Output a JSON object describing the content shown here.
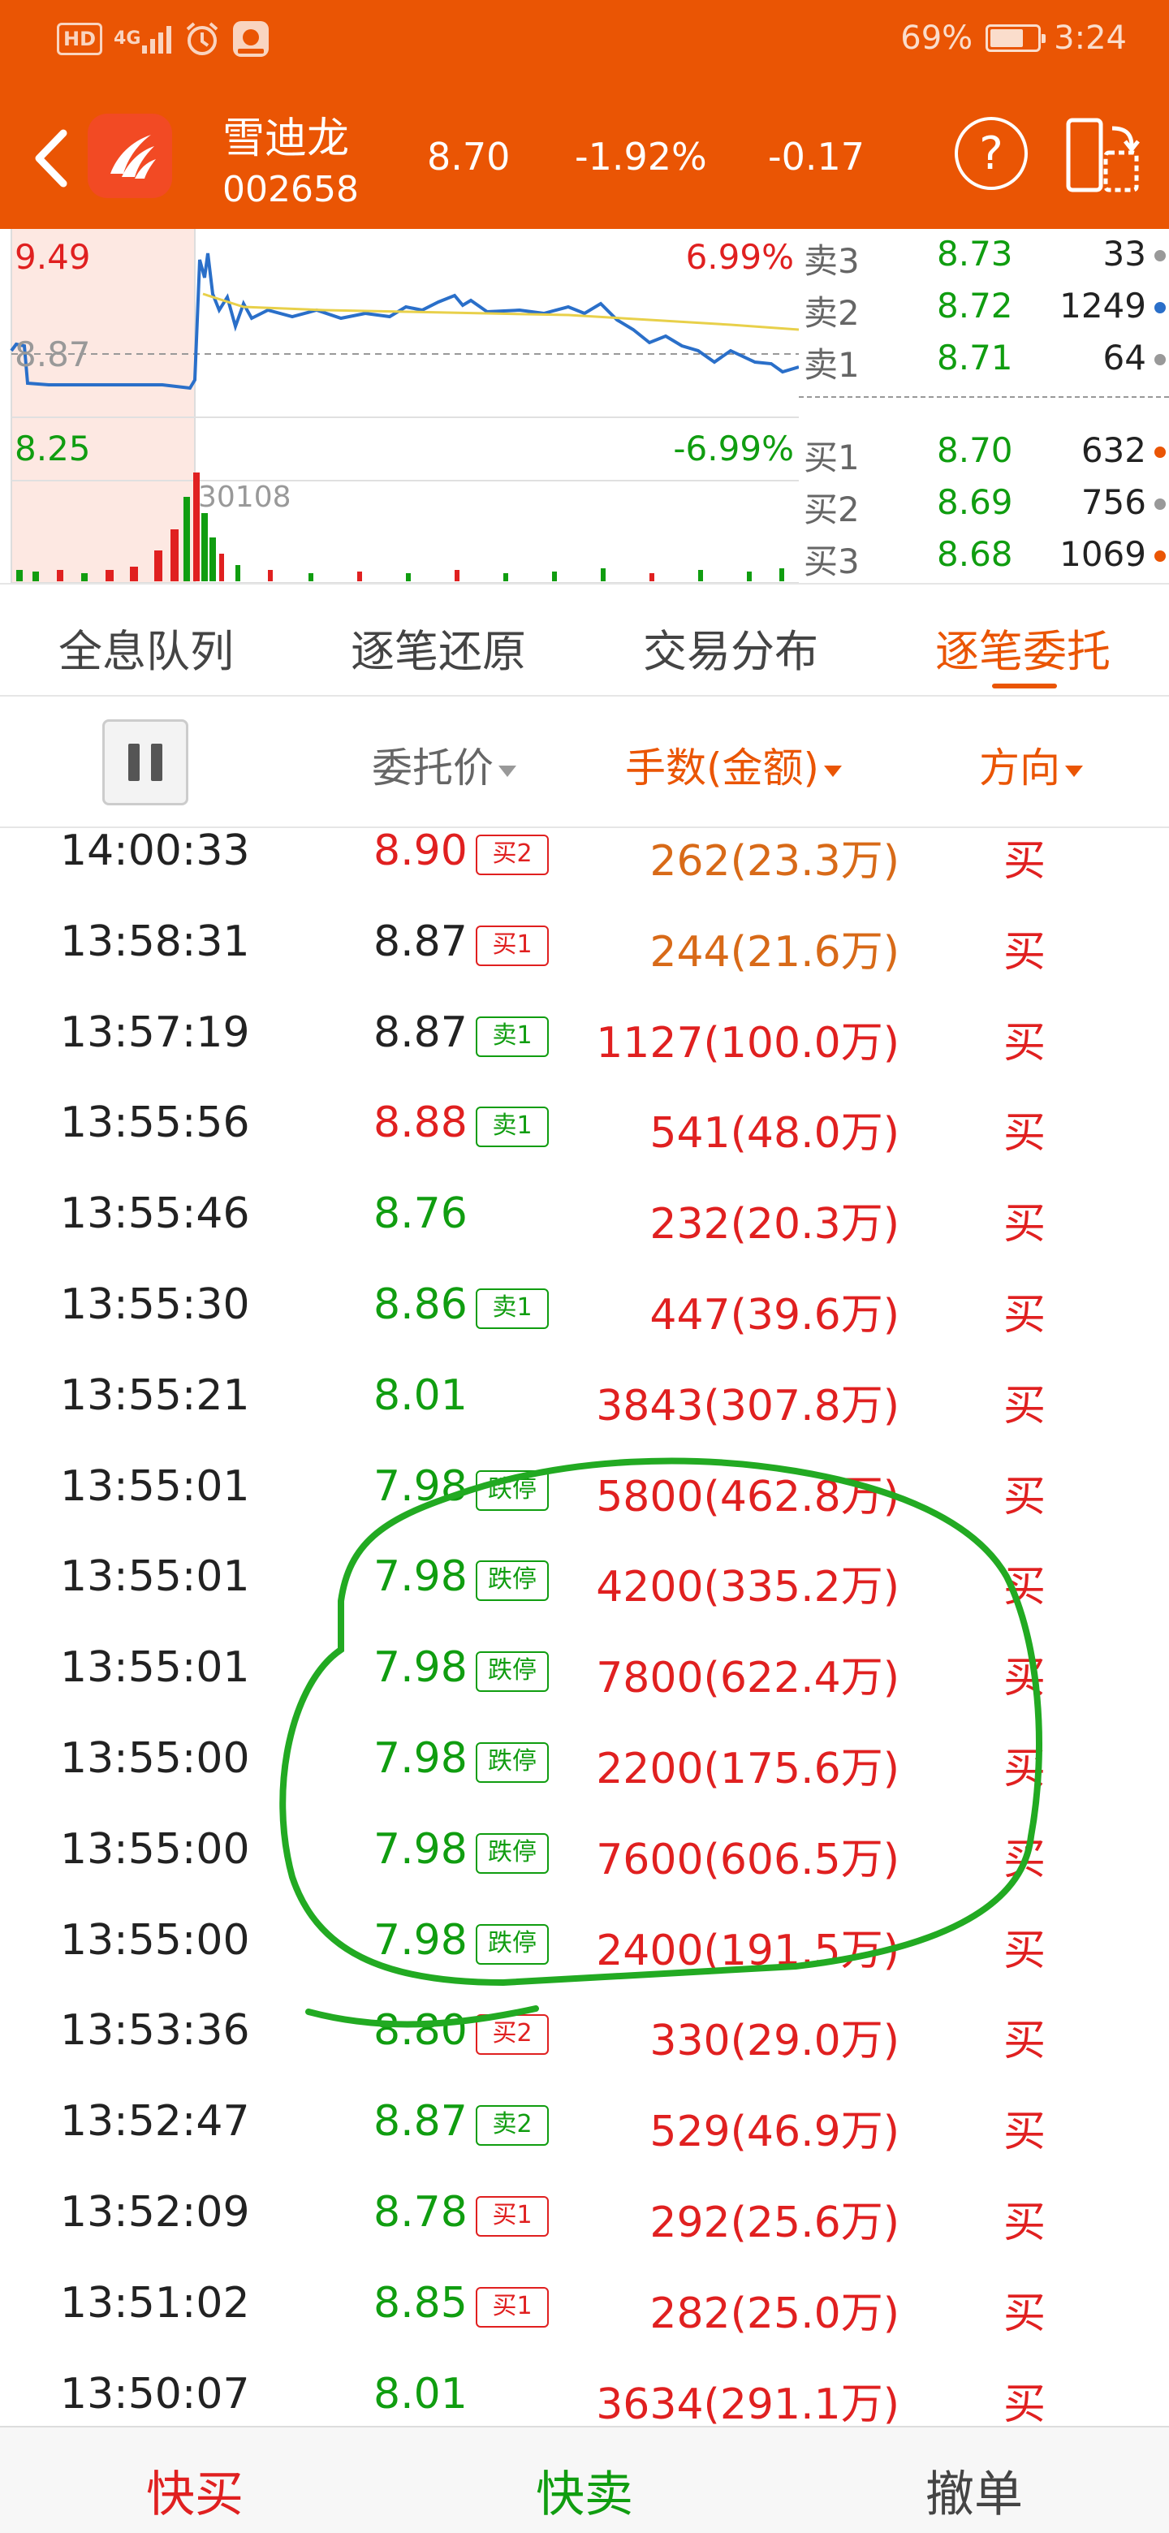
{
  "status_bar": {
    "hd": "HD",
    "network": "4G",
    "battery": "69%",
    "time": "3:24",
    "icons": [
      "signal-icon",
      "alarm-icon",
      "app-notification-icon",
      "battery-icon"
    ]
  },
  "header": {
    "name": "雪迪龙",
    "code": "002658",
    "price": "8.70",
    "change_pct": "-1.92%",
    "change": "-0.17",
    "help_symbol": "?",
    "icons": [
      "back-arrow-icon",
      "brand-logo-icon",
      "help-icon",
      "landscape-switch-icon"
    ]
  },
  "chart": {
    "high": "9.49",
    "mid": "8.87",
    "low": "8.25",
    "high_pct": "6.99%",
    "low_pct": "-6.99%",
    "volume_label": "30108"
  },
  "order_book": {
    "asks": [
      {
        "label": "卖3",
        "price": "8.73",
        "vol": "33",
        "dot": "#999999"
      },
      {
        "label": "卖2",
        "price": "8.72",
        "vol": "1249",
        "dot": "#2a6fc9"
      },
      {
        "label": "卖1",
        "price": "8.71",
        "vol": "64",
        "dot": "#999999"
      }
    ],
    "bids": [
      {
        "label": "买1",
        "price": "8.70",
        "vol": "632",
        "dot": "#ea5504"
      },
      {
        "label": "买2",
        "price": "8.69",
        "vol": "756",
        "dot": "#999999"
      },
      {
        "label": "买3",
        "price": "8.68",
        "vol": "1069",
        "dot": "#ea5504"
      }
    ]
  },
  "tabs": [
    "全息队列",
    "逐笔还原",
    "交易分布",
    "逐笔委托"
  ],
  "active_tab": "逐笔委托",
  "columns": {
    "price": "委托价",
    "qty": "手数(金额)",
    "dir": "方向"
  },
  "rows": [
    {
      "time": "14:00:33",
      "price": "8.90",
      "price_color": "red",
      "tag": "买2",
      "tag_type": "buy",
      "qty": "262(23.3万)",
      "qty_color": "orange",
      "dir": "买"
    },
    {
      "time": "13:58:31",
      "price": "8.87",
      "price_color": "black",
      "tag": "买1",
      "tag_type": "buy",
      "qty": "244(21.6万)",
      "qty_color": "orange",
      "dir": "买"
    },
    {
      "time": "13:57:19",
      "price": "8.87",
      "price_color": "black",
      "tag": "卖1",
      "tag_type": "sell",
      "qty": "1127(100.0万)",
      "qty_color": "red",
      "dir": "买"
    },
    {
      "time": "13:55:56",
      "price": "8.88",
      "price_color": "red",
      "tag": "卖1",
      "tag_type": "sell",
      "qty": "541(48.0万)",
      "qty_color": "red",
      "dir": "买"
    },
    {
      "time": "13:55:46",
      "price": "8.76",
      "price_color": "green",
      "tag": "",
      "tag_type": "",
      "qty": "232(20.3万)",
      "qty_color": "red",
      "dir": "买"
    },
    {
      "time": "13:55:30",
      "price": "8.86",
      "price_color": "green",
      "tag": "卖1",
      "tag_type": "sell",
      "qty": "447(39.6万)",
      "qty_color": "red",
      "dir": "买"
    },
    {
      "time": "13:55:21",
      "price": "8.01",
      "price_color": "green",
      "tag": "",
      "tag_type": "",
      "qty": "3843(307.8万)",
      "qty_color": "red",
      "dir": "买"
    },
    {
      "time": "13:55:01",
      "price": "7.98",
      "price_color": "green",
      "tag": "跌停",
      "tag_type": "sell",
      "qty": "5800(462.8万)",
      "qty_color": "red",
      "dir": "买"
    },
    {
      "time": "13:55:01",
      "price": "7.98",
      "price_color": "green",
      "tag": "跌停",
      "tag_type": "sell",
      "qty": "4200(335.2万)",
      "qty_color": "red",
      "dir": "买"
    },
    {
      "time": "13:55:01",
      "price": "7.98",
      "price_color": "green",
      "tag": "跌停",
      "tag_type": "sell",
      "qty": "7800(622.4万)",
      "qty_color": "red",
      "dir": "买"
    },
    {
      "time": "13:55:00",
      "price": "7.98",
      "price_color": "green",
      "tag": "跌停",
      "tag_type": "sell",
      "qty": "2200(175.6万)",
      "qty_color": "red",
      "dir": "买"
    },
    {
      "time": "13:55:00",
      "price": "7.98",
      "price_color": "green",
      "tag": "跌停",
      "tag_type": "sell",
      "qty": "7600(606.5万)",
      "qty_color": "red",
      "dir": "买"
    },
    {
      "time": "13:55:00",
      "price": "7.98",
      "price_color": "green",
      "tag": "跌停",
      "tag_type": "sell",
      "qty": "2400(191.5万)",
      "qty_color": "red",
      "dir": "买"
    },
    {
      "time": "13:53:36",
      "price": "8.80",
      "price_color": "green",
      "tag": "买2",
      "tag_type": "buy",
      "qty": "330(29.0万)",
      "qty_color": "red",
      "dir": "买"
    },
    {
      "time": "13:52:47",
      "price": "8.87",
      "price_color": "green",
      "tag": "卖2",
      "tag_type": "sell",
      "qty": "529(46.9万)",
      "qty_color": "red",
      "dir": "买"
    },
    {
      "time": "13:52:09",
      "price": "8.78",
      "price_color": "green",
      "tag": "买1",
      "tag_type": "buy",
      "qty": "292(25.6万)",
      "qty_color": "red",
      "dir": "买"
    },
    {
      "time": "13:51:02",
      "price": "8.85",
      "price_color": "green",
      "tag": "买1",
      "tag_type": "buy",
      "qty": "282(25.0万)",
      "qty_color": "red",
      "dir": "买"
    },
    {
      "time": "13:50:07",
      "price": "8.01",
      "price_color": "green",
      "tag": "",
      "tag_type": "",
      "qty": "3634(291.1万)",
      "qty_color": "red",
      "dir": "买"
    }
  ],
  "bottom": {
    "buy": "快买",
    "sell": "快卖",
    "cancel": "撤单"
  },
  "colors": {
    "brand": "#ea5504",
    "up": "#e02020",
    "down": "#109d10",
    "annotation": "#22aa22"
  }
}
